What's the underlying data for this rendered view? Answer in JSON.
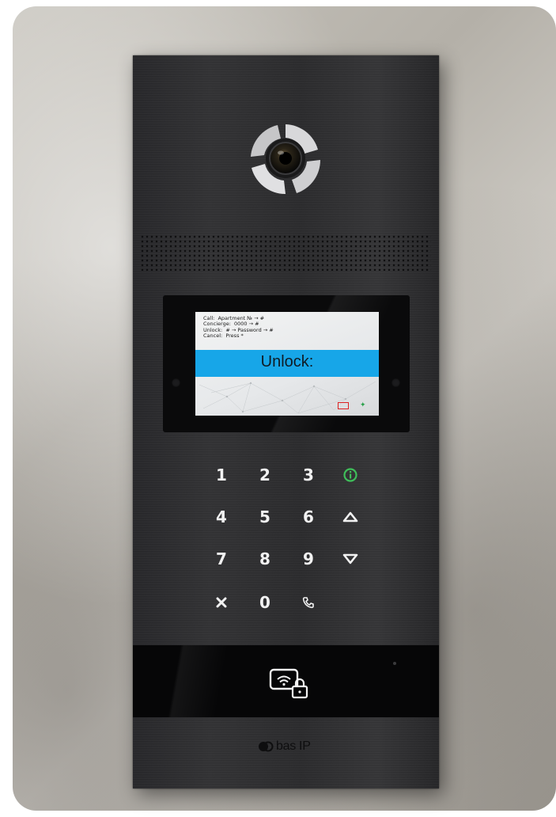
{
  "screen": {
    "help_lines": [
      "Call:  Apartment № → #",
      "Concierge:  0000 → #",
      "Unlock:  # → Password → #",
      "Cancel:  Press *"
    ],
    "prompt": "Unlock:",
    "band_color": "#17a6e8"
  },
  "keypad": {
    "rows": [
      [
        {
          "label": "1"
        },
        {
          "label": "2"
        },
        {
          "label": "3"
        },
        {
          "icon": "info-icon",
          "color": "#3fbf5a"
        }
      ],
      [
        {
          "label": "4"
        },
        {
          "label": "5"
        },
        {
          "label": "6"
        },
        {
          "icon": "arrow-up-icon"
        }
      ],
      [
        {
          "label": "7"
        },
        {
          "label": "8"
        },
        {
          "label": "9"
        },
        {
          "icon": "arrow-down-icon"
        }
      ],
      [
        {
          "icon": "cancel-icon"
        },
        {
          "label": "0"
        },
        {
          "icon": "phone-icon"
        }
      ]
    ]
  },
  "reader": {
    "icon": "nfc-card-lock-icon"
  },
  "brand": {
    "name": "bas IP"
  }
}
